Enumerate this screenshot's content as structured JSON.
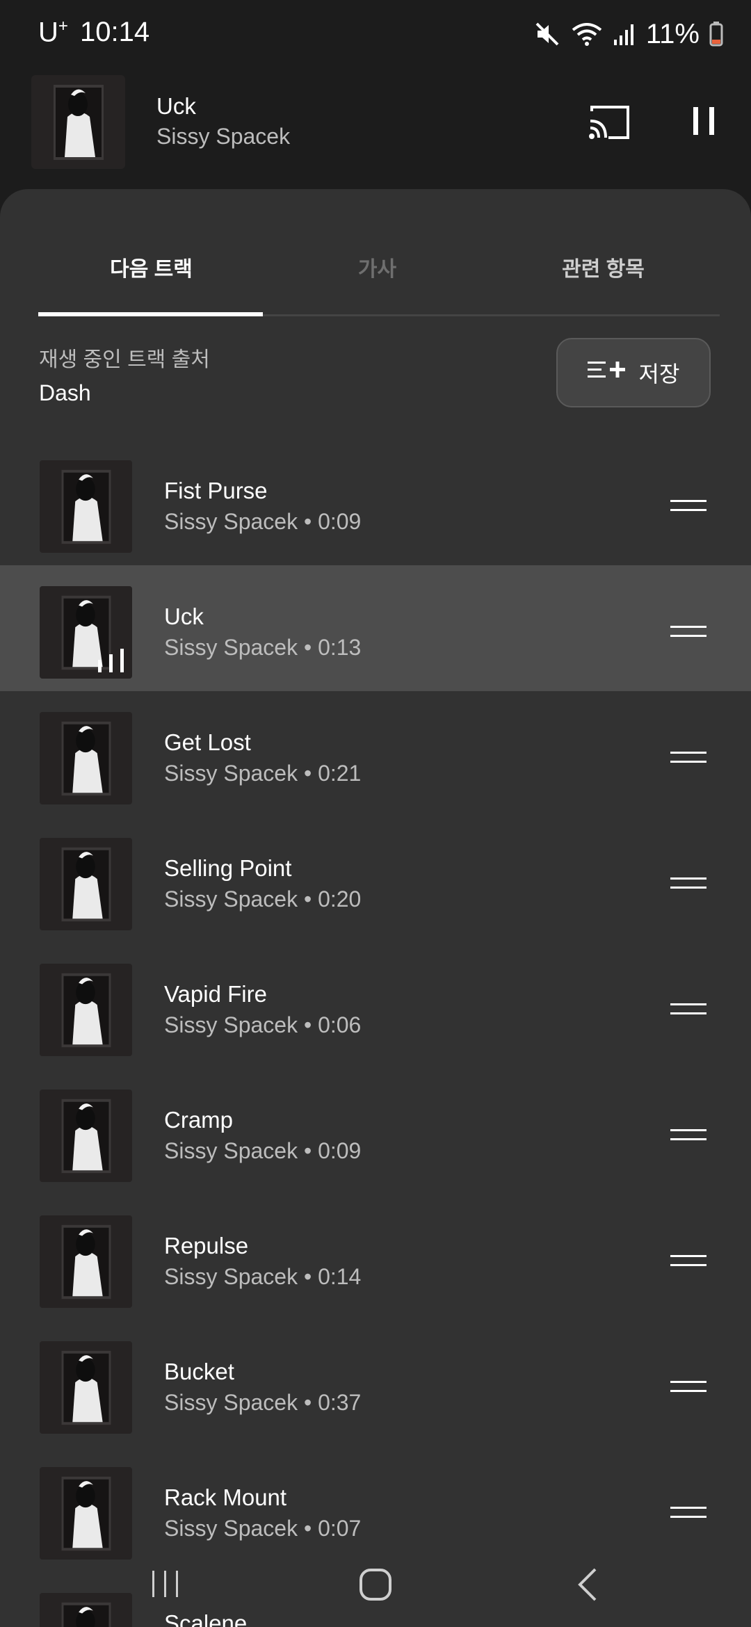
{
  "status_bar": {
    "carrier": "U",
    "carrier_sup": "+",
    "time": "10:14",
    "battery": "11%",
    "icons": [
      "mute-icon",
      "wifi-icon",
      "signal-icon",
      "battery-icon"
    ]
  },
  "mini_player": {
    "title": "Uck",
    "artist": "Sissy Spacek",
    "icons": [
      "cast-icon",
      "pause-icon"
    ]
  },
  "tabs": [
    {
      "label": "다음 트랙",
      "selected": true
    },
    {
      "label": "가사",
      "selected": false
    },
    {
      "label": "관련 항목",
      "selected": false
    }
  ],
  "source": {
    "label": "재생 중인 트랙 출처",
    "name": "Dash"
  },
  "save_button": {
    "label": "저장"
  },
  "queue": [
    {
      "title": "Fist Purse",
      "subtitle": "Sissy Spacek • 0:09",
      "playing": false
    },
    {
      "title": "Uck",
      "subtitle": "Sissy Spacek • 0:13",
      "playing": true
    },
    {
      "title": "Get Lost",
      "subtitle": "Sissy Spacek • 0:21",
      "playing": false
    },
    {
      "title": "Selling Point",
      "subtitle": "Sissy Spacek • 0:20",
      "playing": false
    },
    {
      "title": "Vapid Fire",
      "subtitle": "Sissy Spacek • 0:06",
      "playing": false
    },
    {
      "title": "Cramp",
      "subtitle": "Sissy Spacek • 0:09",
      "playing": false
    },
    {
      "title": "Repulse",
      "subtitle": "Sissy Spacek • 0:14",
      "playing": false
    },
    {
      "title": "Bucket",
      "subtitle": "Sissy Spacek • 0:37",
      "playing": false
    },
    {
      "title": "Rack Mount",
      "subtitle": "Sissy Spacek • 0:07",
      "playing": false
    },
    {
      "title": "Scalene",
      "subtitle": "",
      "playing": false
    }
  ],
  "nav_bar": [
    "recents-icon",
    "home-icon",
    "back-icon"
  ]
}
